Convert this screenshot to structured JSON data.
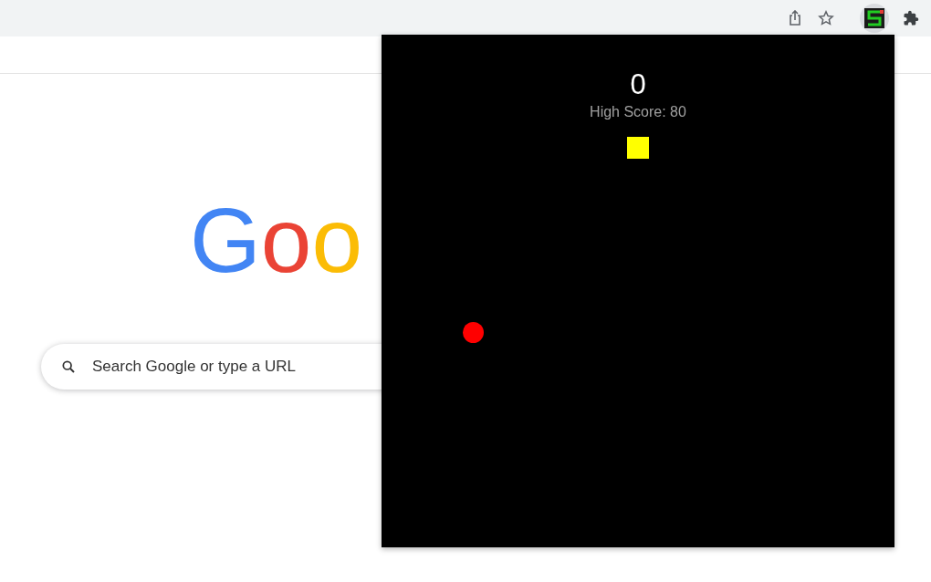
{
  "google_logo": [
    {
      "char": "G",
      "color": "#4285f4"
    },
    {
      "char": "o",
      "color": "#ea4335"
    },
    {
      "char": "o",
      "color": "#fbbc05"
    }
  ],
  "search": {
    "placeholder": "Search Google or type a URL"
  },
  "game_popup": {
    "score": "0",
    "high_score": "High Score: 80"
  }
}
